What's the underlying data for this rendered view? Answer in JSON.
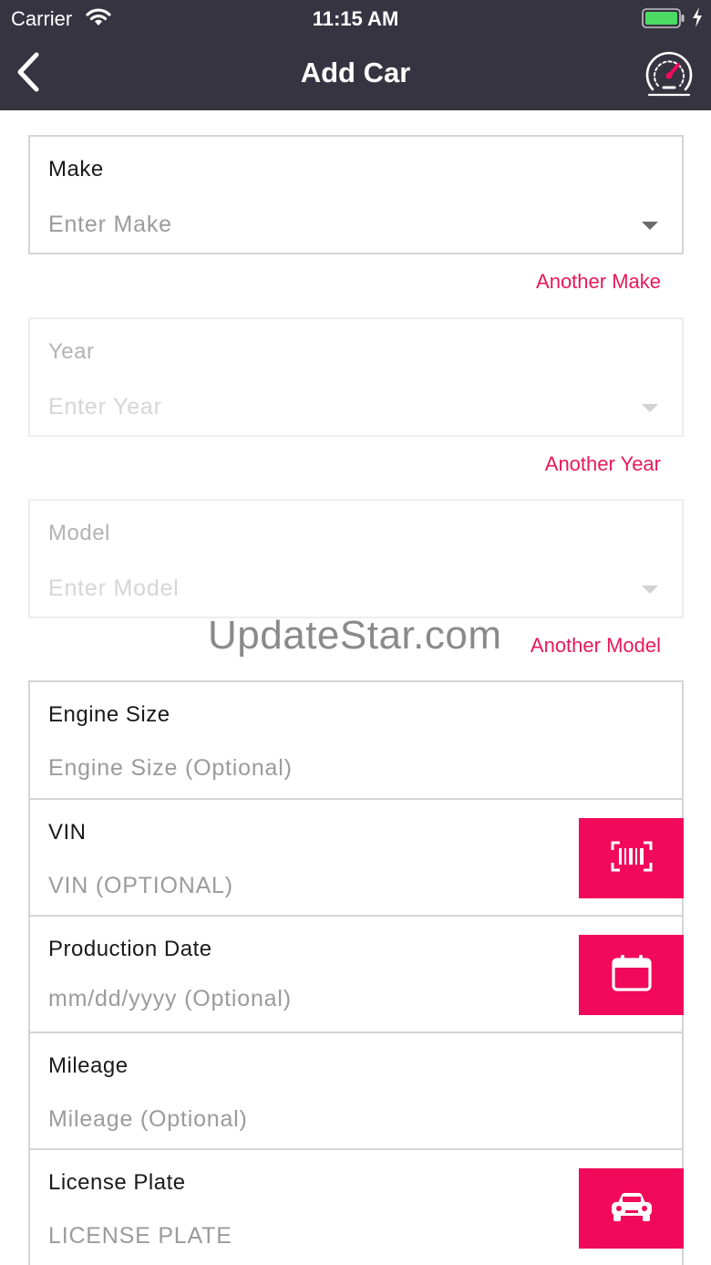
{
  "status_bar": {
    "carrier": "Carrier",
    "time": "11:15 AM"
  },
  "nav": {
    "title": "Add Car"
  },
  "make": {
    "label": "Make",
    "placeholder": "Enter Make",
    "link": "Another Make"
  },
  "year": {
    "label": "Year",
    "placeholder": "Enter Year",
    "link": "Another Year"
  },
  "model": {
    "label": "Model",
    "placeholder": "Enter Model",
    "link": "Another Model"
  },
  "watermark": "UpdateStar.com",
  "engine": {
    "label": "Engine Size",
    "placeholder": "Engine Size (Optional)"
  },
  "vin": {
    "label": "VIN",
    "placeholder": "VIN (OPTIONAL)"
  },
  "production_date": {
    "label": "Production Date",
    "placeholder": "mm/dd/yyyy (Optional)"
  },
  "mileage": {
    "label": "Mileage",
    "placeholder": "Mileage (Optional)"
  },
  "license_plate": {
    "label": "License Plate",
    "placeholder": "LICENSE PLATE"
  },
  "colors": {
    "header": "#373441",
    "accent": "#f20a5a",
    "link": "#e8195a"
  },
  "icons": [
    "wifi-icon",
    "battery-icon",
    "charging-bolt-icon",
    "back-chevron-icon",
    "speedometer-icon",
    "dropdown-caret-icon",
    "barcode-scan-icon",
    "calendar-icon",
    "car-icon"
  ]
}
